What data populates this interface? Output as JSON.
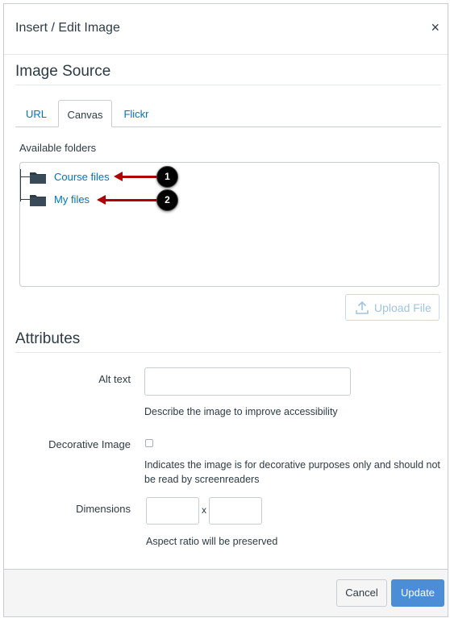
{
  "dialog": {
    "title": "Insert / Edit Image",
    "close_glyph": "×"
  },
  "image_source": {
    "heading": "Image Source",
    "tabs": [
      {
        "label": "URL",
        "active": false
      },
      {
        "label": "Canvas",
        "active": true
      },
      {
        "label": "Flickr",
        "active": false
      }
    ],
    "folders_label": "Available folders",
    "folders": [
      {
        "label": "Course files",
        "icon": "folder-icon",
        "callout": "1"
      },
      {
        "label": "My files",
        "icon": "folder-icon",
        "callout": "2"
      }
    ],
    "upload_button": {
      "label": "Upload File",
      "icon": "upload-icon"
    }
  },
  "attributes": {
    "heading": "Attributes",
    "alt_text": {
      "label": "Alt text",
      "value": "",
      "help": "Describe the image to improve accessibility"
    },
    "decorative": {
      "label": "Decorative Image",
      "checked": false,
      "help": "Indicates the image is for decorative purposes only and should not be read by screenreaders"
    },
    "dimensions": {
      "label": "Dimensions",
      "width": "",
      "height": "",
      "separator": "x",
      "help": "Aspect ratio will be preserved"
    }
  },
  "footer": {
    "cancel_label": "Cancel",
    "update_label": "Update"
  },
  "colors": {
    "link": "#0074c0",
    "primary_button": "#4c8ed5",
    "callout_arrow": "#b00000",
    "callout_badge": "#000000"
  }
}
